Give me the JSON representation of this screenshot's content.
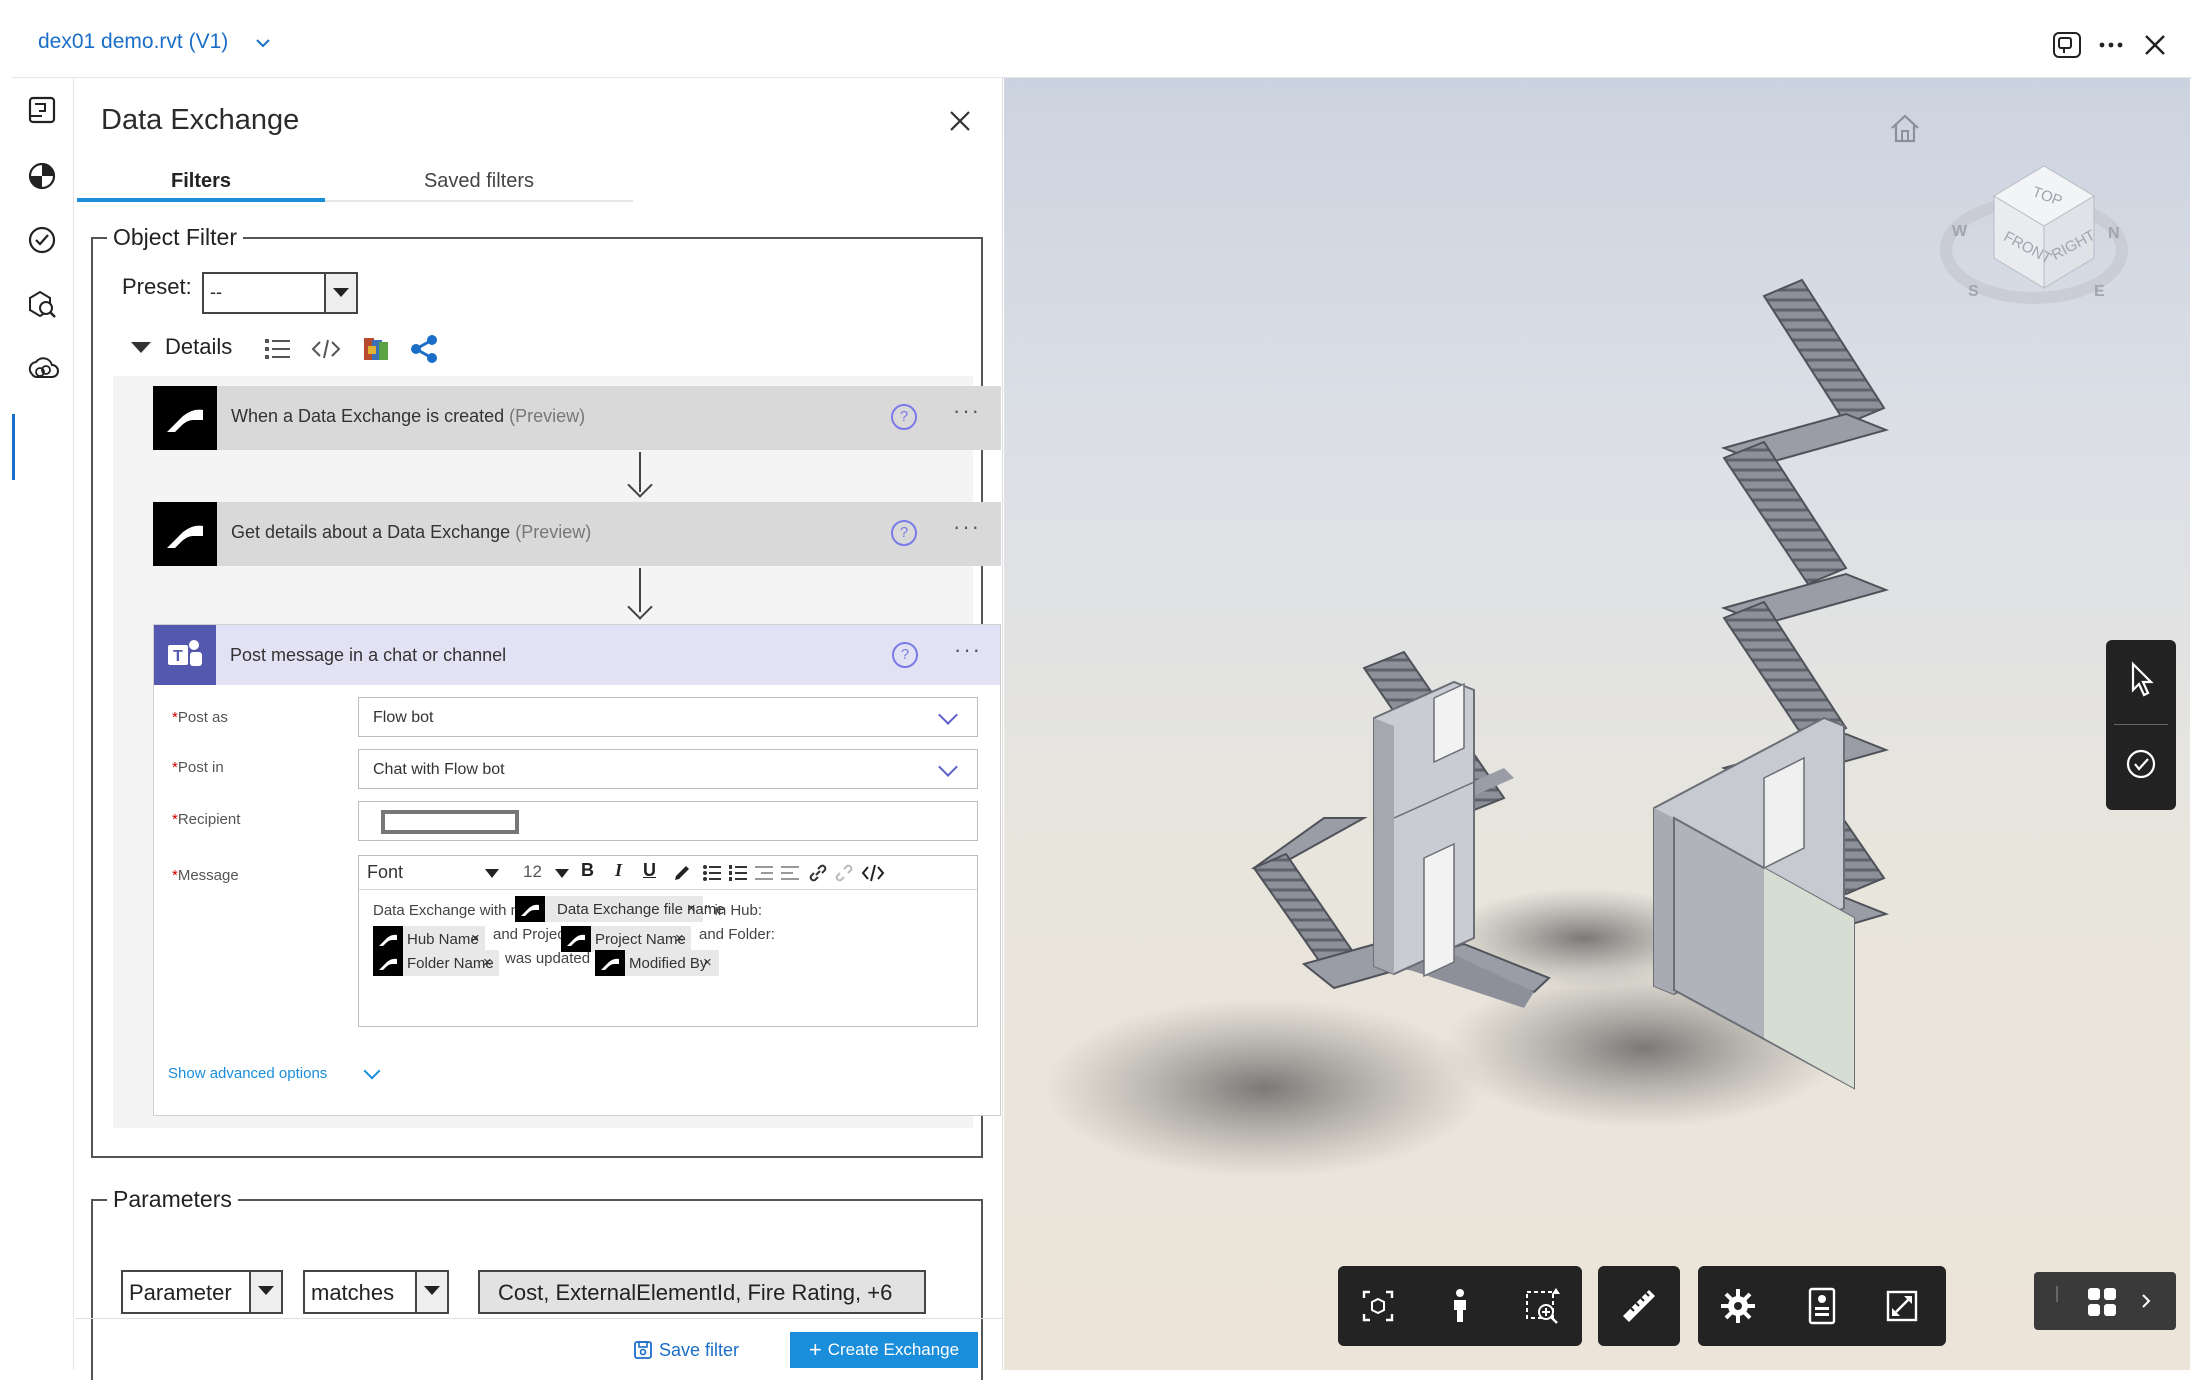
{
  "document": {
    "title": "dex01 demo.rvt  (V1)"
  },
  "panel": {
    "title": "Data Exchange",
    "tabs": [
      {
        "label": "Filters"
      },
      {
        "label": "Saved filters"
      }
    ],
    "object_filter": {
      "legend": "Object Filter",
      "preset_label": "Preset:",
      "preset_value": "--",
      "details_label": "Details"
    },
    "flow": {
      "card1": {
        "title": "When a Data Exchange is created",
        "preview": "(Preview)"
      },
      "card2": {
        "title": "Get details about a Data Exchange",
        "preview": "(Preview)"
      },
      "card3": {
        "title": "Post message in a chat or channel",
        "post_as_label": "Post as",
        "post_as_value": "Flow bot",
        "post_in_label": "Post in",
        "post_in_value": "Chat with Flow bot",
        "recipient_label": "Recipient",
        "message_label": "Message",
        "font_label": "Font",
        "font_size": "12",
        "msg_text1": "Data Exchange with name \"",
        "token_exchange": "Data Exchange file name",
        "msg_text2": "\" in Hub:",
        "token_hub": "Hub Name",
        "msg_text3": "and Project:",
        "token_project": "Project Name",
        "msg_text4": "and Folder:",
        "token_folder": "Folder Name",
        "msg_text5": "was updated by",
        "token_modified": "Modified By",
        "advanced": "Show advanced options"
      },
      "help_glyph": "?",
      "more_glyph": "···",
      "required_mark": "*",
      "token_remove": "×"
    },
    "parameters": {
      "legend": "Parameters",
      "param_field": "Parameter",
      "operator": "matches",
      "values": "Cost, ExternalElementId, Fire Rating, +6"
    },
    "footer": {
      "save_filter": "Save filter",
      "create_exchange": "Create Exchange"
    }
  },
  "icons": {
    "topbar": [
      "compare-icon",
      "more-icon",
      "close-icon"
    ],
    "rail": [
      "sheets-icon",
      "model-browser-icon",
      "issues-icon",
      "search-3d-icon",
      "data-exchange-icon"
    ],
    "viewer": [
      "home-icon",
      "viewcube",
      "select-icon",
      "markup-check-icon",
      "fit-to-view-icon",
      "first-person-icon",
      "zoom-window-icon",
      "measure-icon",
      "settings-icon",
      "properties-icon",
      "fullscreen-icon",
      "grid-apps-icon"
    ]
  },
  "viewcube": {
    "top": "TOP",
    "front": "FRONT",
    "right": "RIGHT",
    "north": "N",
    "south": "S",
    "east": "E",
    "west": "W"
  },
  "colors": {
    "accent": "#1a8ddb",
    "link": "#1a6ec7",
    "teams": "#5558af",
    "toolbar": "#232323"
  }
}
